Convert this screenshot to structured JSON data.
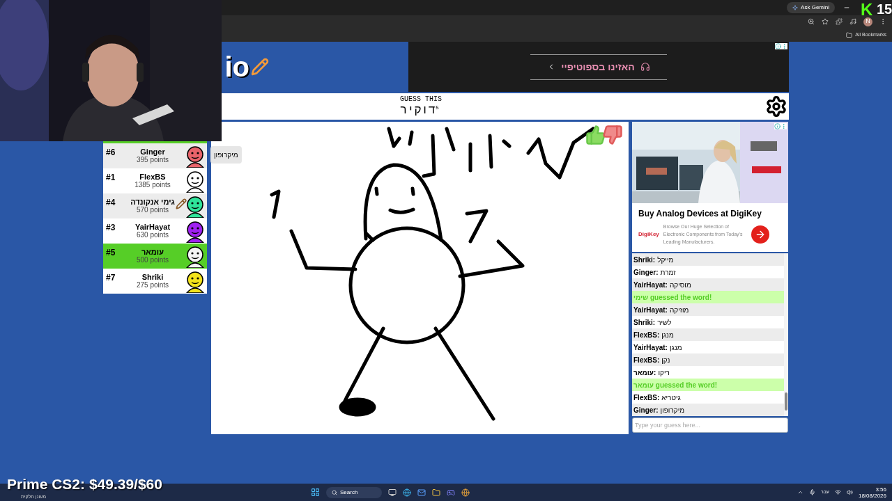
{
  "browser": {
    "ask_button": "Ask Gemini",
    "profile": "N",
    "bookmarks": "All Bookmarks"
  },
  "overlay": {
    "logo": "K",
    "count": "15",
    "goal": "Prime CS2: $49.39/$60"
  },
  "game": {
    "logo": "io",
    "banner_ad": {
      "text": "האזינו בספוטיפיי"
    },
    "header": {
      "label": "GUESS THIS",
      "word": "דוקיר",
      "letters": "5"
    },
    "players": [
      {
        "rank": "#6",
        "name": "Ginger",
        "points": "395 points",
        "color": "#e8636a",
        "selected": false,
        "drawing": false,
        "bubble": "מיקרופון"
      },
      {
        "rank": "#1",
        "name": "FlexBS",
        "points": "1385 points",
        "color": "#ffffff",
        "selected": false,
        "drawing": false
      },
      {
        "rank": "#4",
        "name": "גימי אנקונדה",
        "points": "570 points",
        "color": "#2fe39a",
        "selected": false,
        "drawing": true
      },
      {
        "rank": "#3",
        "name": "YairHayat",
        "points": "630 points",
        "color": "#a020f0",
        "selected": false,
        "drawing": false
      },
      {
        "rank": "#5",
        "name": "עומאר",
        "points": "500 points",
        "color": "#f4f4f4",
        "selected": true,
        "drawing": false
      },
      {
        "rank": "#7",
        "name": "Shriki",
        "points": "275 points",
        "color": "#f2e21c",
        "selected": false,
        "drawing": false
      }
    ],
    "side_ad": {
      "title": "Buy Analog Devices at DigiKey",
      "brand": "DigiKey",
      "description": "Browse Our Huge Selection of Electronic Components from Today's Leading Manufacturers."
    },
    "chat": [
      {
        "kind": "message",
        "author": "Shriki:",
        "text": "מייקל"
      },
      {
        "kind": "message",
        "author": "Ginger:",
        "text": "זמרת"
      },
      {
        "kind": "message",
        "author": "YairHayat:",
        "text": "מוסיקה"
      },
      {
        "kind": "guessed",
        "text": "שימי guessed the word!"
      },
      {
        "kind": "message",
        "author": "YairHayat:",
        "text": "מוזיקה"
      },
      {
        "kind": "message",
        "author": "Shriki:",
        "text": "לשיר"
      },
      {
        "kind": "message",
        "author": "FlexBS:",
        "text": "מנגן"
      },
      {
        "kind": "message",
        "author": "YairHayat:",
        "text": "מנגן"
      },
      {
        "kind": "message",
        "author": "FlexBS:",
        "text": "נקן"
      },
      {
        "kind": "message",
        "author": "עומאר:",
        "text": "ריקו"
      },
      {
        "kind": "guessed",
        "text": "עומאר guessed the word!"
      },
      {
        "kind": "message",
        "author": "FlexBS:",
        "text": "גיטריא"
      },
      {
        "kind": "message",
        "author": "Ginger:",
        "text": "מיקרופון"
      }
    ],
    "guess_input": {
      "placeholder": "Type your guess here..."
    }
  },
  "taskbar": {
    "weather": "מעונן חלקית",
    "search": "Search",
    "language": "עבר",
    "time": "3:56",
    "date": "18/08/2026"
  }
}
